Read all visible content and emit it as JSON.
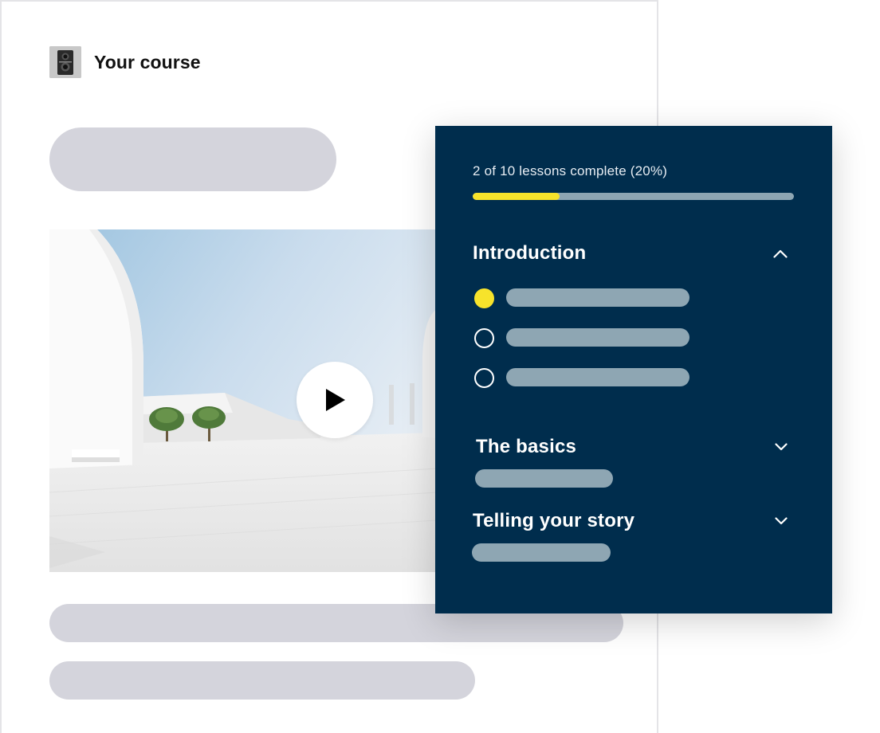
{
  "course": {
    "title": "Your course",
    "thumbnail_icon": "vintage-camera-icon"
  },
  "video": {
    "play_icon": "play-icon"
  },
  "progress": {
    "label": "2 of 10 lessons complete (20%)",
    "fraction": 0.27,
    "fill_color": "#f7e32b"
  },
  "sections": [
    {
      "title": "Introduction",
      "expanded": true,
      "chevron": "chevron-up-icon",
      "lessons": [
        {
          "complete": true
        },
        {
          "complete": false
        },
        {
          "complete": false
        }
      ]
    },
    {
      "title": "The basics",
      "expanded": false,
      "chevron": "chevron-down-icon"
    },
    {
      "title": "Telling your story",
      "expanded": false,
      "chevron": "chevron-down-icon"
    }
  ],
  "colors": {
    "panel_bg": "#002d4d",
    "accent": "#f7e32b",
    "placeholder": "#d4d4dc",
    "muted_bar": "#8ea6b3"
  }
}
